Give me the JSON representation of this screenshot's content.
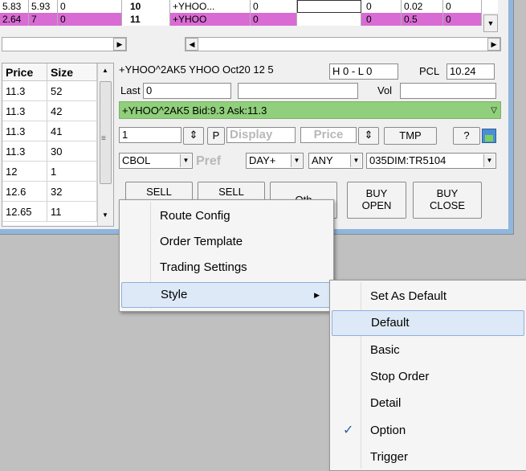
{
  "top_rows": [
    {
      "c1": "5.83",
      "c2": "5.93",
      "c3": "0",
      "c4": "10",
      "c5": "+YHOO...",
      "c6": "0",
      "c8": "0",
      "c9": "0.02",
      "c10": "0"
    },
    {
      "c1": "2.64",
      "c2": "7",
      "c3": "0",
      "c4": "11",
      "c5": "+YHOO",
      "c6": "0",
      "c8": "0",
      "c9": "0.5",
      "c10": "0"
    }
  ],
  "left_table": {
    "headers": [
      "Price",
      "Size"
    ],
    "rows": [
      [
        "11.3",
        "52"
      ],
      [
        "11.3",
        "42"
      ],
      [
        "11.3",
        "41"
      ],
      [
        "11.3",
        "30"
      ],
      [
        "12",
        "1"
      ],
      [
        "12.6",
        "32"
      ],
      [
        "12.65",
        "11"
      ]
    ]
  },
  "order_panel": {
    "header_text": "+YHOO^2AK5 YHOO Oct20 12 5",
    "hl_value": "H 0 - L 0",
    "pcl_label": "PCL",
    "pcl_value": "10.24",
    "last_label": "Last",
    "last_value": "0",
    "vol_label": "Vol",
    "quote_text": "+YHOO^2AK5 Bid:9.3 Ask:11.3",
    "quantity": "1",
    "p_label": "P",
    "display_label": "Display",
    "price_placeholder": "Price",
    "tmp_label": "TMP",
    "help_label": "?",
    "route": "CBOL",
    "pref_label": "Pref",
    "tif": "DAY+",
    "cond": "ANY",
    "account": "035DIM:TR5104",
    "buttons": [
      "SELL",
      "SELL",
      "Oth",
      "BUY\nOPEN",
      "BUY\nCLOSE"
    ]
  },
  "context_menu": {
    "items": [
      "Route Config",
      "Order Template",
      "Trading Settings",
      "Style"
    ]
  },
  "style_submenu": {
    "items": [
      "Set As Default",
      "Default",
      "Basic",
      "Stop Order",
      "Detail",
      "Option",
      "Trigger"
    ],
    "checked": "Option",
    "highlighted": "Default"
  },
  "colors": {
    "pink_row": "#d86bd4",
    "quote_green": "#90cf7b",
    "menu_highlight": "#dde9f7"
  }
}
